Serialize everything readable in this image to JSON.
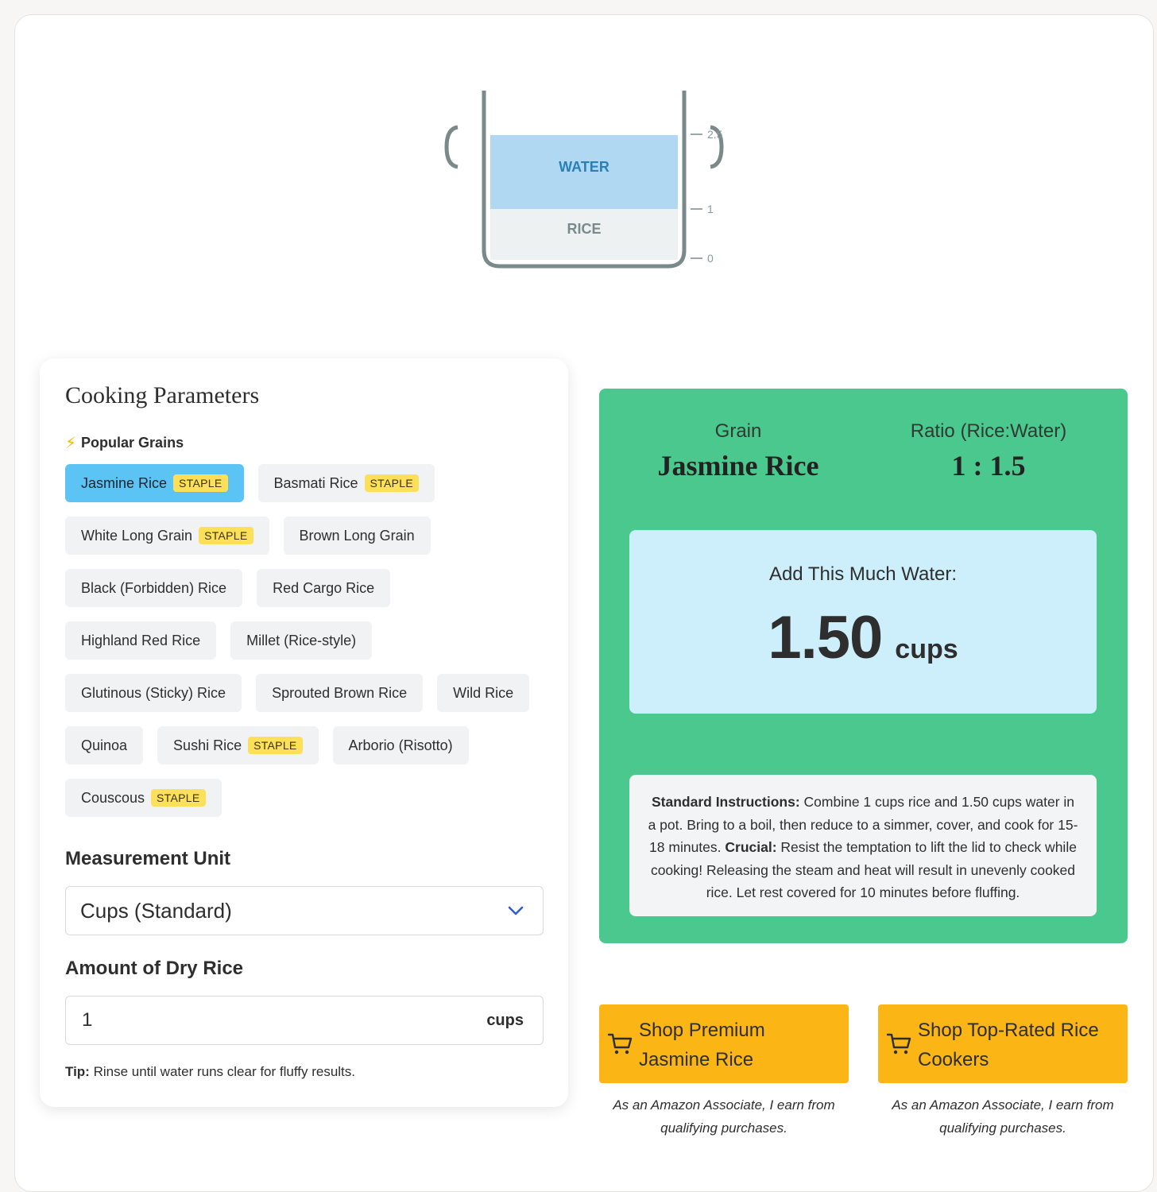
{
  "pot": {
    "water_label": "WATER",
    "rice_label": "RICE",
    "ticks": [
      "2.5",
      "1",
      "0"
    ],
    "water_level_fraction": 0.71,
    "rice_level_fraction": 0.29
  },
  "parameters": {
    "title": "Cooking Parameters",
    "popular_heading": "Popular Grains",
    "popular_icon": "lightning-bolt-icon",
    "grains": [
      {
        "label": "Jasmine Rice",
        "badge": "STAPLE",
        "active": true
      },
      {
        "label": "Basmati Rice",
        "badge": "STAPLE",
        "active": false
      },
      {
        "label": "White Long Grain",
        "badge": "STAPLE",
        "active": false
      },
      {
        "label": "Brown Long Grain",
        "badge": "",
        "active": false
      },
      {
        "label": "Black (Forbidden) Rice",
        "badge": "",
        "active": false
      },
      {
        "label": "Red Cargo Rice",
        "badge": "",
        "active": false
      },
      {
        "label": "Highland Red Rice",
        "badge": "",
        "active": false
      },
      {
        "label": "Millet (Rice-style)",
        "badge": "",
        "active": false
      },
      {
        "label": "Glutinous (Sticky) Rice",
        "badge": "",
        "active": false
      },
      {
        "label": "Sprouted Brown Rice",
        "badge": "",
        "active": false
      },
      {
        "label": "Wild Rice",
        "badge": "",
        "active": false
      },
      {
        "label": "Quinoa",
        "badge": "",
        "active": false
      },
      {
        "label": "Sushi Rice",
        "badge": "STAPLE",
        "active": false
      },
      {
        "label": "Arborio (Risotto)",
        "badge": "",
        "active": false
      },
      {
        "label": "Couscous",
        "badge": "STAPLE",
        "active": false
      }
    ],
    "unit_heading": "Measurement Unit",
    "unit_selected": "Cups (Standard)",
    "amount_heading": "Amount of Dry Rice",
    "amount_value": "1",
    "amount_unit": "cups",
    "tip_label": "Tip:",
    "tip_text": " Rinse until water runs clear for fluffy results."
  },
  "result": {
    "grain_label": "Grain",
    "grain_value": "Jasmine Rice",
    "ratio_label": "Ratio (Rice:Water)",
    "ratio_value": "1 : 1.5",
    "water_title": "Add This Much Water:",
    "water_amount": "1.50",
    "water_unit": "cups",
    "instructions": {
      "standard_label": "Standard Instructions:",
      "standard_text": " Combine 1 cups rice and 1.50 cups water in a pot. Bring to a boil, then reduce to a simmer, cover, and cook for 15-18 minutes. ",
      "crucial_label": "Crucial:",
      "crucial_text": " Resist the temptation to lift the lid to check while cooking! Releasing the steam and heat will result in unevenly cooked rice. Let rest covered for 10 minutes before fluffing."
    }
  },
  "shop": [
    {
      "label": "Shop Premium Jasmine Rice",
      "icon": "cart-icon",
      "disclaimer": "As an Amazon Associate, I earn from qualifying purchases."
    },
    {
      "label": "Shop Top-Rated Rice Cookers",
      "icon": "cart-icon",
      "disclaimer": "As an Amazon Associate, I earn from qualifying purchases."
    }
  ],
  "colors": {
    "accent_green": "#4bc88e",
    "active_chip": "#5cc3f5",
    "badge_yellow": "#fde05a",
    "shop_yellow": "#fbb514",
    "water_fill": "#b0d8f2",
    "water_text": "#2980b9"
  }
}
